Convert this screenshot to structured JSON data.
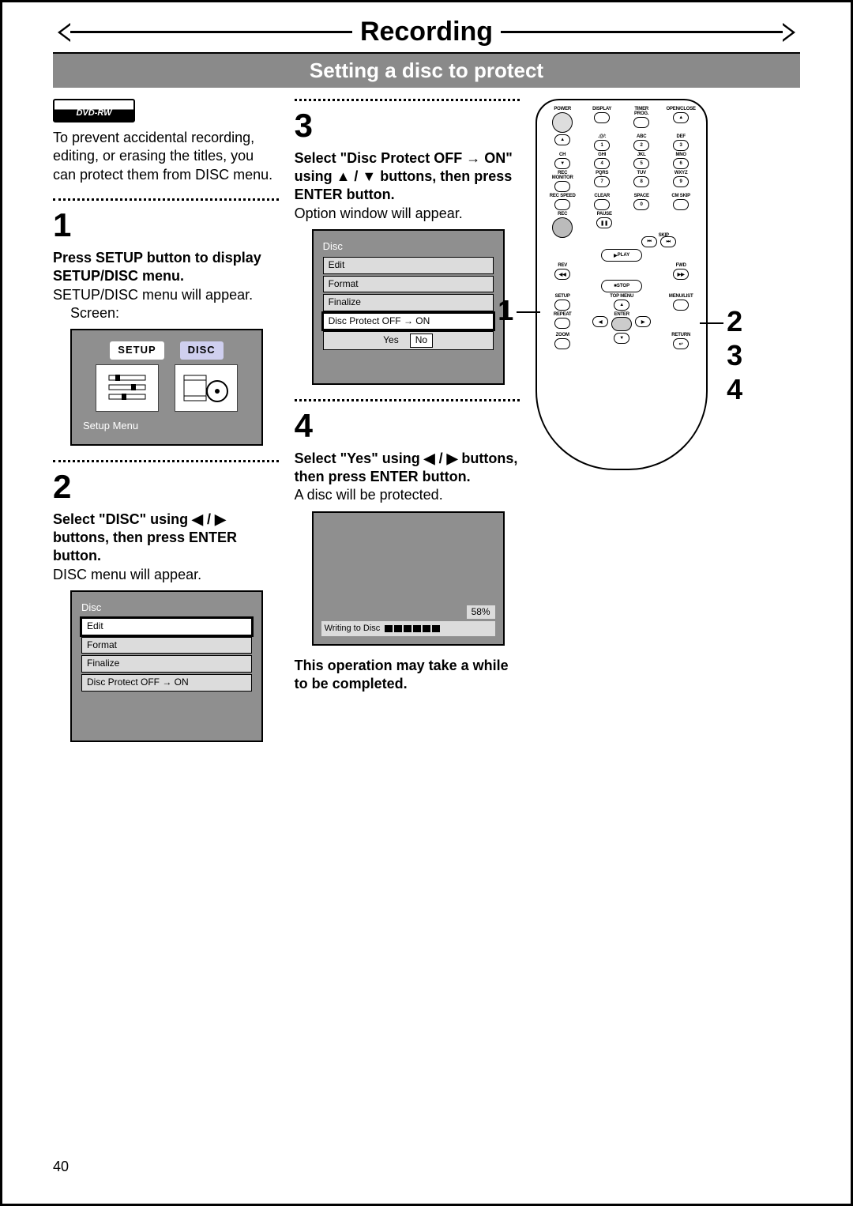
{
  "header": {
    "title": "Recording",
    "subtitle": "Setting a disc to protect"
  },
  "badge": "DVD-RW",
  "intro": "To prevent accidental recording, editing, or erasing the titles, you can protect them from DISC menu.",
  "step1": {
    "num": "1",
    "heading": "Press SETUP button to display SETUP/DISC menu.",
    "body": "SETUP/DISC menu will appear.",
    "screen_label": "Screen:",
    "fig": {
      "tab1": "SETUP",
      "tab2": "DISC",
      "caption": "Setup Menu"
    }
  },
  "step2": {
    "num": "2",
    "heading": "Select \"DISC\" using ◀ / ▶ buttons, then press ENTER button.",
    "body": "DISC menu will appear.",
    "menu": {
      "title": "Disc",
      "items": [
        "Edit",
        "Format",
        "Finalize",
        "Disc Protect OFF → ON"
      ]
    }
  },
  "step3": {
    "num": "3",
    "heading": "Select \"Disc Protect OFF → ON\" using ▲ / ▼ buttons, then press ENTER button.",
    "body": "Option window will appear.",
    "menu": {
      "title": "Disc",
      "items": [
        "Edit",
        "Format",
        "Finalize",
        "Disc Protect OFF → ON"
      ],
      "yes": "Yes",
      "no": "No"
    }
  },
  "step4": {
    "num": "4",
    "heading": "Select \"Yes\" using ◀ / ▶ buttons, then press ENTER button.",
    "body": "A disc will be protected.",
    "progress": {
      "pct": "58%",
      "label": "Writing to Disc"
    },
    "note": "This operation may take a while to be completed."
  },
  "remote": {
    "labels": {
      "power": "POWER",
      "display": "DISPLAY",
      "timer": "TIMER\nPROG.",
      "open": "OPEN/CLOSE",
      "at": ".@/:",
      "abc": "ABC",
      "def": "DEF",
      "ch": "CH",
      "ghi": "GHI",
      "jkl": "JKL",
      "mno": "MNO",
      "rec_mon": "REC\nMONITOR",
      "pqrs": "PQRS",
      "tuv": "TUV",
      "wxyz": "WXYZ",
      "rec_speed": "REC SPEED",
      "clear": "CLEAR",
      "space": "SPACE",
      "cmskip": "CM SKIP",
      "rec": "REC",
      "pause": "PAUSE",
      "skip": "SKIP",
      "play": "PLAY",
      "rev": "REV",
      "fwd": "FWD",
      "stop": "STOP",
      "setup": "SETUP",
      "topmenu": "TOP MENU",
      "menulist": "MENU/LIST",
      "repeat": "REPEAT",
      "enter": "ENTER",
      "zoom": "ZOOM",
      "return": "RETURN"
    },
    "nums": {
      "n1": "1",
      "n2": "2",
      "n3": "3",
      "n4": "4",
      "n5": "5",
      "n6": "6",
      "n7": "7",
      "n8": "8",
      "n9": "9",
      "n0": "0"
    },
    "callout_left": "1",
    "callout_right": [
      "2",
      "3",
      "4"
    ]
  },
  "page_number": "40"
}
